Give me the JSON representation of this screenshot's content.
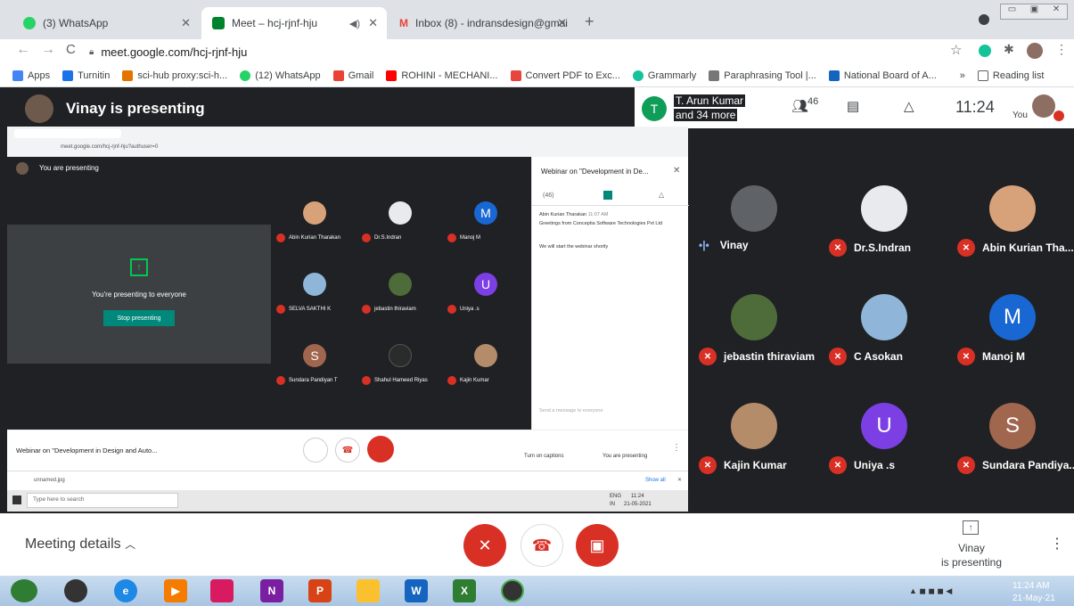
{
  "browser": {
    "tabs": [
      {
        "label": "(3) WhatsApp",
        "color": "#25d366"
      },
      {
        "label": "Meet – hcj-rjnf-hju",
        "color": "#00832d"
      },
      {
        "label": "Inbox (8) - indransdesign@gmai",
        "color": "#ea4335"
      }
    ],
    "new_tab": "+",
    "url": "meet.google.com/hcj-rjnf-hju",
    "bookmarks": [
      {
        "label": "Apps",
        "color": "#4285f4"
      },
      {
        "label": "Turnitin",
        "color": "#1a73e8"
      },
      {
        "label": "sci-hub proxy:sci-h...",
        "color": "#e37400"
      },
      {
        "label": "(12) WhatsApp",
        "color": "#25d366"
      },
      {
        "label": "Gmail",
        "color": "#ea4335"
      },
      {
        "label": "ROHINI - MECHANI...",
        "color": "#ff0000"
      },
      {
        "label": "Convert PDF to Exc...",
        "color": "#e8453c"
      },
      {
        "label": "Grammarly",
        "color": "#15c39a"
      },
      {
        "label": "Paraphrasing Tool |...",
        "color": "#777777"
      },
      {
        "label": "National Board of A...",
        "color": "#1565c0"
      }
    ],
    "more": "»",
    "reading_list": "Reading list"
  },
  "meet": {
    "presenter": "Vinay is presenting",
    "joined_name": "T. Arun Kumar",
    "joined_more": "and 34 more",
    "joined_initial": "T",
    "participant_count": "46",
    "time": "11:24",
    "you_label": "You",
    "participants": [
      {
        "name": "Vinay",
        "muted": false,
        "color": "#5f6368",
        "initial": ""
      },
      {
        "name": "Dr.S.Indran",
        "muted": true,
        "color": "#e8eaed",
        "initial": ""
      },
      {
        "name": "Abin Kurian Tha...",
        "muted": true,
        "color": "#d7a27a",
        "initial": ""
      },
      {
        "name": "jebastin thiraviam",
        "muted": true,
        "color": "#4e6b3a",
        "initial": ""
      },
      {
        "name": "C Asokan",
        "muted": true,
        "color": "#8fb6d8",
        "initial": ""
      },
      {
        "name": "Manoj M",
        "muted": true,
        "color": "#1967d2",
        "initial": "M"
      },
      {
        "name": "Kajin Kumar",
        "muted": true,
        "color": "#b58c6a",
        "initial": ""
      },
      {
        "name": "Uniya .s",
        "muted": true,
        "color": "#7b3fe4",
        "initial": "U"
      },
      {
        "name": "Sundara Pandiya...",
        "muted": true,
        "color": "#a1664e",
        "initial": "S"
      }
    ],
    "meeting_details": "Meeting details",
    "presenting_line1": "Vinay",
    "presenting_line2": "is presenting"
  },
  "shared": {
    "url": "meet.google.com/hcj-rjnf-hju?authuser=0",
    "you_are_presenting": "You are presenting",
    "presenting_everyone": "You're presenting to everyone",
    "stop_presenting": "Stop presenting",
    "panel_title": "Webinar on \"Development in De...",
    "panel_count": "(46)",
    "chat_sender": "Abin Kurian Tharakan",
    "chat_time": "11:07 AM",
    "chat_msg1": "Greetings from Conceptia Software Technologies Pvt Ltd",
    "chat_msg2": "We will start the webinar shortly",
    "send_placeholder": "Send a message to everyone",
    "meeting_title": "Webinar on \"Development in Design and Auto...",
    "captions": "Turn on captions",
    "you_presenting": "You are presenting",
    "download_file": "unnamed.jpg",
    "show_all": "Show all",
    "search_placeholder": "Type here to search",
    "tray_lang": "ENG",
    "tray_region": "IN",
    "tray_time": "11:24",
    "tray_date": "21-05-2021",
    "mini_participants": [
      {
        "name": "Abin Kurian Tharakan",
        "color": "#d7a27a",
        "initial": ""
      },
      {
        "name": "Dr.S.Indran",
        "color": "#e8eaed",
        "initial": ""
      },
      {
        "name": "Manoj M",
        "color": "#1967d2",
        "initial": "M"
      },
      {
        "name": "SELVA SAKTHI K",
        "color": "#8fb6d8",
        "initial": ""
      },
      {
        "name": "jebastin thiraviam",
        "color": "#4e6b3a",
        "initial": ""
      },
      {
        "name": "Uniya .s",
        "color": "#7b3fe4",
        "initial": "U"
      },
      {
        "name": "Sundara Pandiyan T",
        "color": "#a1664e",
        "initial": "S"
      },
      {
        "name": "Shahul Hameed Riyas",
        "color": "#2b2b2b",
        "initial": ""
      },
      {
        "name": "Kajin Kumar",
        "color": "#b58c6a",
        "initial": ""
      }
    ]
  },
  "windows": {
    "clock_time": "11:24 AM",
    "clock_date": "21-May-21"
  }
}
